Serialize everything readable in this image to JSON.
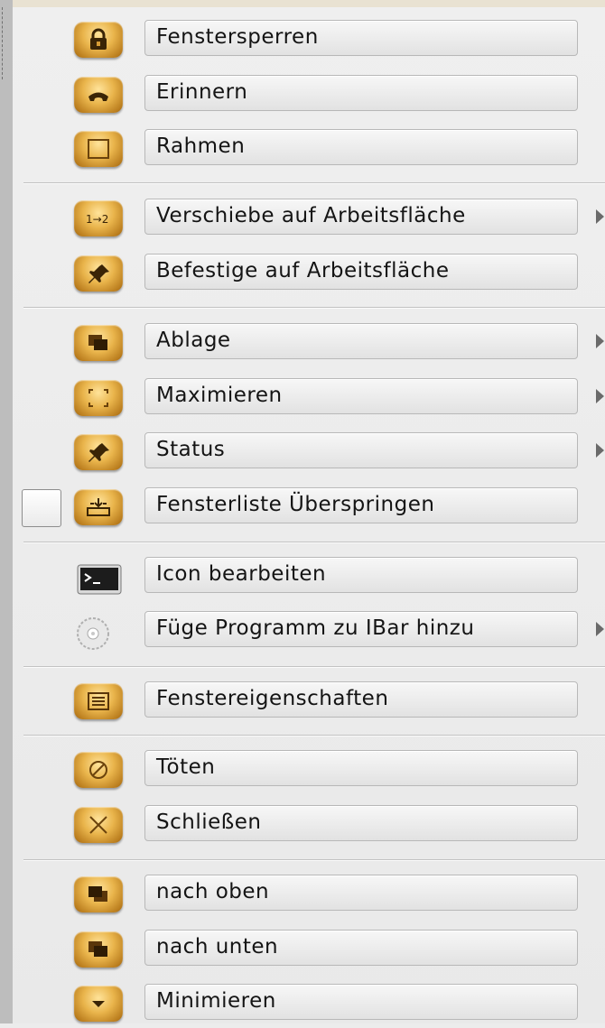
{
  "menu": {
    "items": [
      {
        "label": "Fenstersperren",
        "icon": "lock-icon",
        "submenu": false
      },
      {
        "label": "Erinnern",
        "icon": "phone-icon",
        "submenu": false
      },
      {
        "label": "Rahmen",
        "icon": "frame-icon",
        "submenu": false
      },
      {
        "label": "Verschiebe auf Arbeitsfläche",
        "icon": "move-desktop-icon",
        "submenu": true
      },
      {
        "label": "Befestige auf Arbeitsfläche",
        "icon": "pin-icon",
        "submenu": false
      },
      {
        "label": "Ablage",
        "icon": "stack-icon",
        "submenu": true
      },
      {
        "label": "Maximieren",
        "icon": "maximize-icon",
        "submenu": true
      },
      {
        "label": "Status",
        "icon": "pin-icon",
        "submenu": true
      },
      {
        "label": "Fensterliste Überspringen",
        "icon": "skip-windowlist-icon",
        "submenu": false,
        "checkbox": false
      },
      {
        "label": "Icon bearbeiten",
        "icon": "terminal-icon",
        "submenu": false
      },
      {
        "label": "Füge Programm zu IBar hinzu",
        "icon": "cd-icon",
        "submenu": true
      },
      {
        "label": "Fenstereigenschaften",
        "icon": "properties-icon",
        "submenu": false
      },
      {
        "label": "Töten",
        "icon": "kill-icon",
        "submenu": false
      },
      {
        "label": "Schließen",
        "icon": "close-icon",
        "submenu": false
      },
      {
        "label": "nach oben",
        "icon": "raise-icon",
        "submenu": false
      },
      {
        "label": "nach unten",
        "icon": "lower-icon",
        "submenu": false
      },
      {
        "label": "Minimieren",
        "icon": "minimize-icon",
        "submenu": false
      }
    ],
    "move_icon_text": "1→2"
  },
  "colors": {
    "icon_gold": "#e9b44b",
    "menu_bg": "#ececec",
    "label_border": "#b8b8b8",
    "submenu_arrow": "#6a6a6a"
  }
}
